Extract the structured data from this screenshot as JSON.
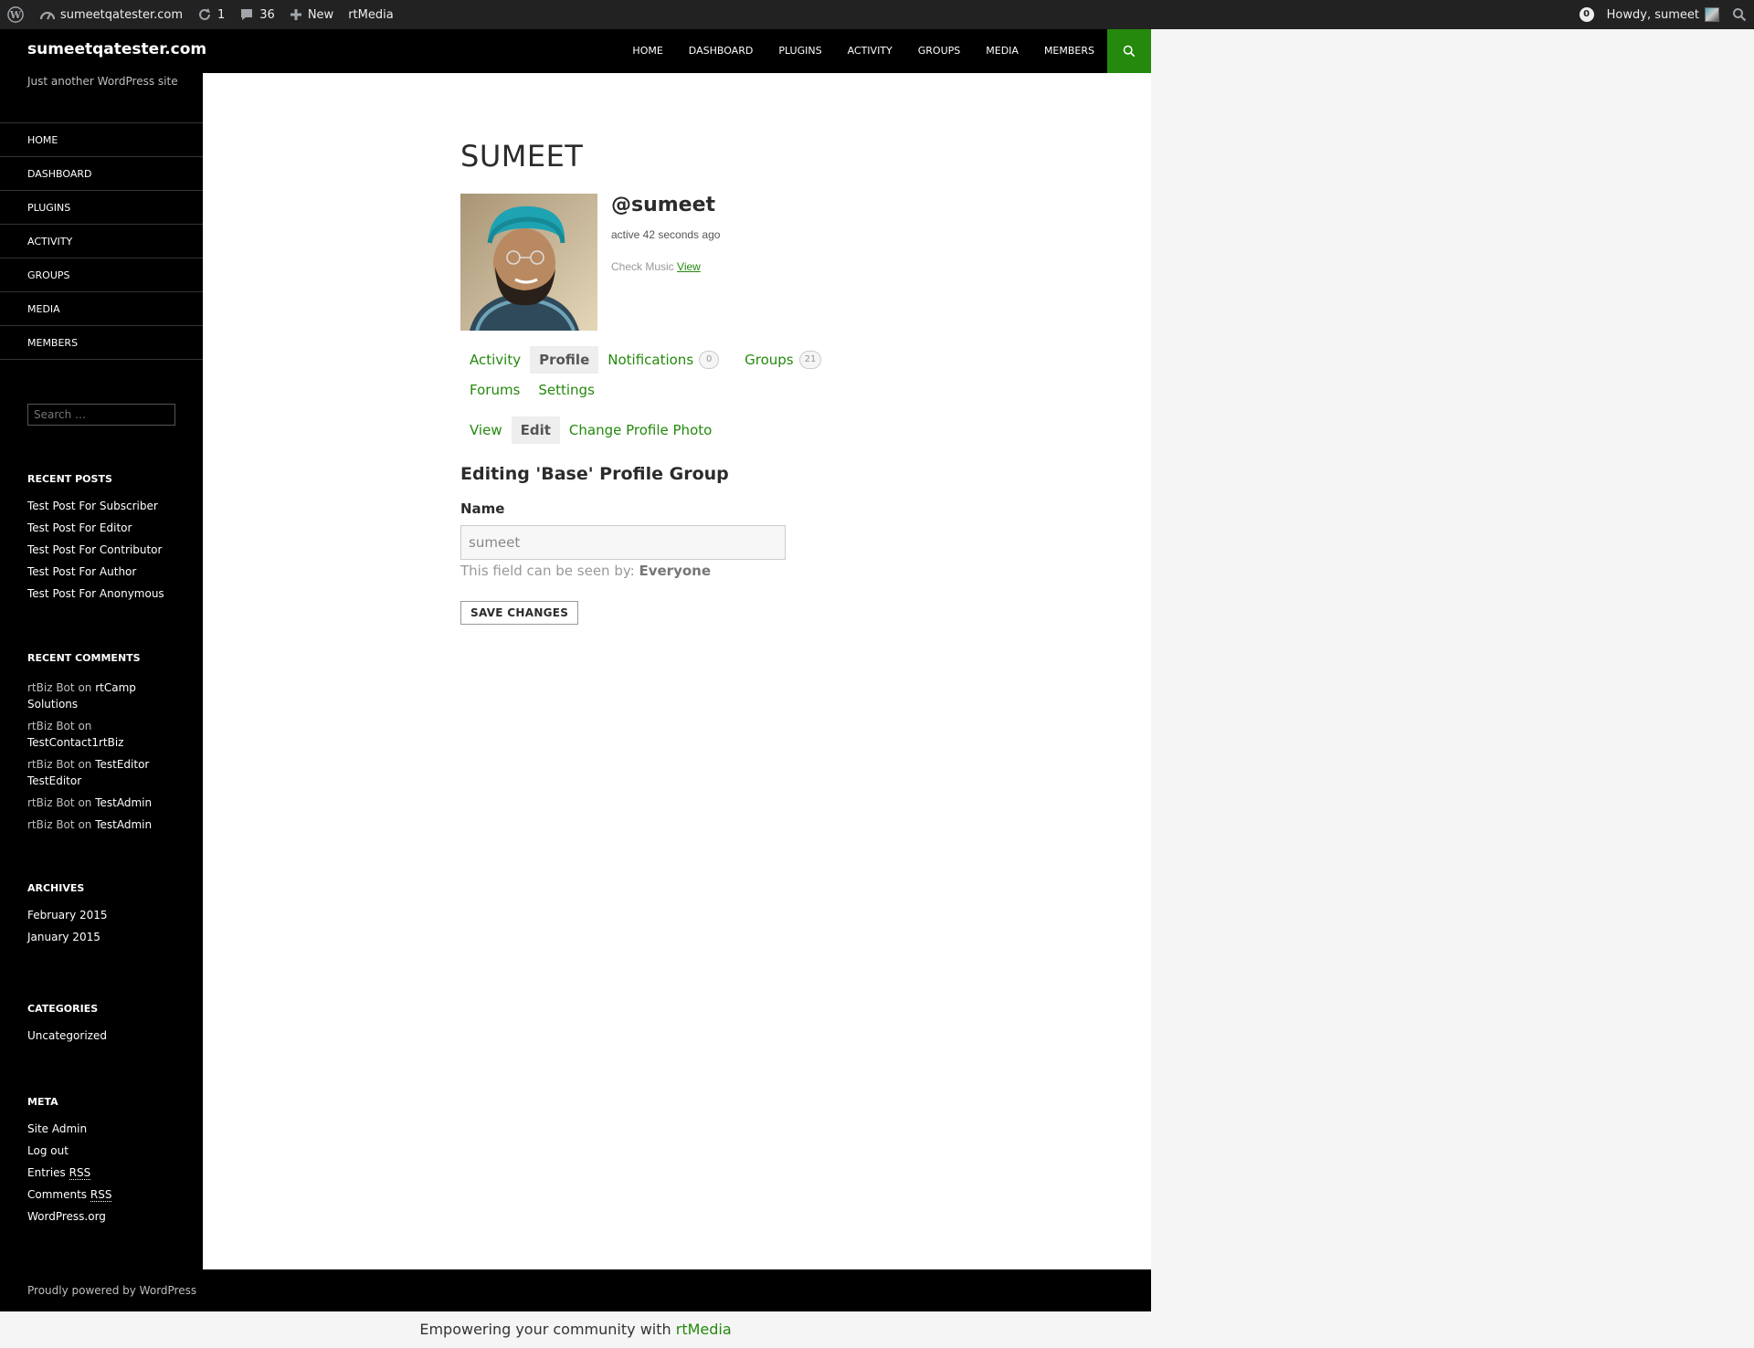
{
  "admin_bar": {
    "site_name": "sumeetqatester.com",
    "updates_count": "1",
    "comments_count": "36",
    "new_label": "New",
    "rtmedia_label": "rtMedia",
    "notifications_count": "0",
    "howdy": "Howdy, sumeet"
  },
  "header": {
    "site_title": "sumeetqatester.com",
    "nav": [
      "HOME",
      "DASHBOARD",
      "PLUGINS",
      "ACTIVITY",
      "GROUPS",
      "MEDIA",
      "MEMBERS"
    ],
    "accent_color": "#24890d"
  },
  "sidebar": {
    "description": "Just another WordPress site",
    "menu": [
      "HOME",
      "DASHBOARD",
      "PLUGINS",
      "ACTIVITY",
      "GROUPS",
      "MEDIA",
      "MEMBERS"
    ],
    "search_placeholder": "Search …",
    "recent_posts": {
      "title": "RECENT POSTS",
      "items": [
        "Test Post For Subscriber",
        "Test Post For Editor",
        "Test Post For Contributor",
        "Test Post For Author",
        "Test Post For Anonymous"
      ]
    },
    "recent_comments": {
      "title": "RECENT COMMENTS",
      "items": [
        {
          "author": "rtBiz Bot",
          "on": "on",
          "post": "rtCamp Solutions"
        },
        {
          "author": "rtBiz Bot",
          "on": "on",
          "post": "TestContact1rtBiz"
        },
        {
          "author": "rtBiz Bot",
          "on": "on",
          "post": "TestEditor TestEditor"
        },
        {
          "author": "rtBiz Bot",
          "on": "on",
          "post": "TestAdmin"
        },
        {
          "author": "rtBiz Bot",
          "on": "on",
          "post": "TestAdmin"
        }
      ]
    },
    "archives": {
      "title": "ARCHIVES",
      "items": [
        "February 2015",
        "January 2015"
      ]
    },
    "categories": {
      "title": "CATEGORIES",
      "items": [
        "Uncategorized"
      ]
    },
    "meta": {
      "title": "META",
      "site_admin": "Site Admin",
      "log_out": "Log out",
      "entries_prefix": "Entries",
      "comments_prefix": "Comments",
      "rss": "RSS",
      "wordpress_org": "WordPress.org"
    }
  },
  "profile": {
    "title": "SUMEET",
    "handle": "@sumeet",
    "activity": "active 42 seconds ago",
    "check_music_label": "Check Music",
    "check_music_link": "View",
    "tabs": {
      "activity": "Activity",
      "profile": "Profile",
      "notifications": "Notifications",
      "notifications_count": "0",
      "groups": "Groups",
      "groups_count": "21",
      "forums": "Forums",
      "settings": "Settings"
    },
    "subtabs": {
      "view": "View",
      "edit": "Edit",
      "change_photo": "Change Profile Photo"
    },
    "form": {
      "title": "Editing 'Base' Profile Group",
      "name_label": "Name",
      "name_value": "sumeet",
      "visibility_prefix": "This field can be seen by:",
      "visibility_level": "Everyone",
      "save_label": "SAVE CHANGES"
    }
  },
  "footer": {
    "credit": "Proudly powered by WordPress",
    "rtmedia_text": "Empowering your community with",
    "rtmedia_link": "rtMedia"
  }
}
